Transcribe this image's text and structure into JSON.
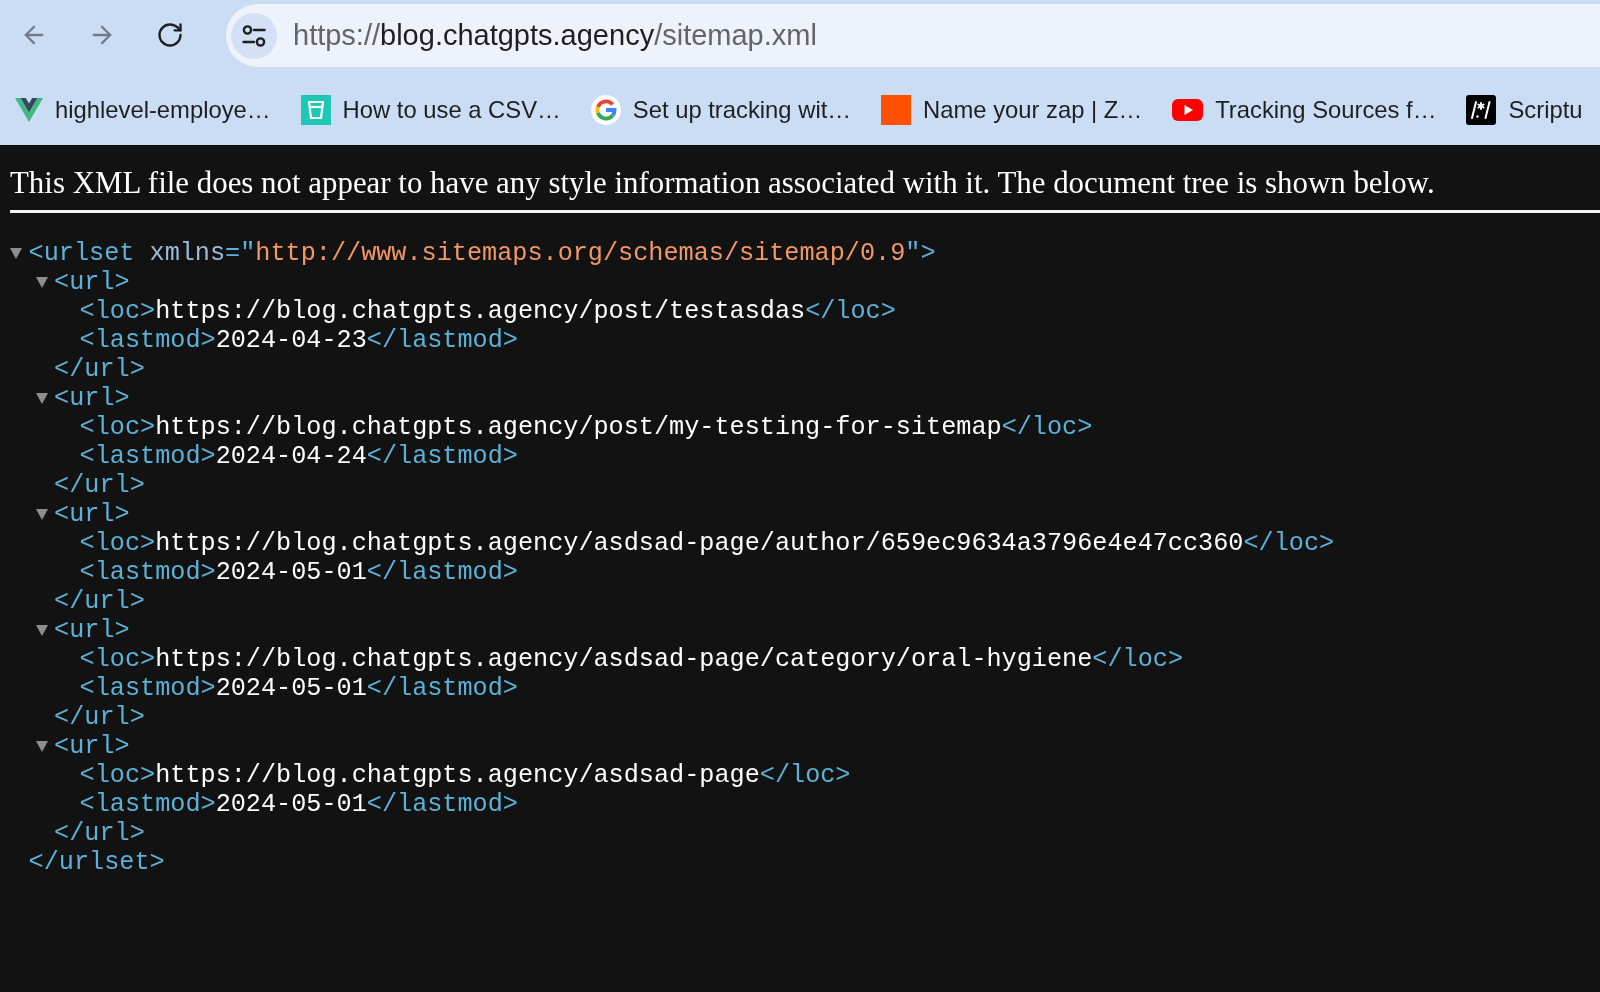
{
  "nav_buttons": [
    {
      "kind": "back",
      "disabled": true
    },
    {
      "kind": "forward",
      "disabled": true
    },
    {
      "kind": "reload",
      "disabled": false
    }
  ],
  "address_bar": {
    "scheme": "https://",
    "host": "blog.chatgpts.agency",
    "path": "/sitemap.xml"
  },
  "bookmarks": [
    {
      "kind": "v-logo",
      "label": "highlevel-employe…"
    },
    {
      "kind": "cup-tile",
      "label": "How to use a CSV…"
    },
    {
      "kind": "g-logo",
      "label": "Set up tracking wit…"
    },
    {
      "kind": "square",
      "label": "Name your zap | Z…"
    },
    {
      "kind": "play",
      "label": "Tracking Sources f…"
    },
    {
      "kind": "slash-tile",
      "label": "Scriptu"
    }
  ],
  "xml_notice": "This XML file does not appear to have any style information associated with it. The document tree is shown below.",
  "xml_tree": {
    "expanded": true,
    "open": [
      {
        "kind": "tag",
        "text": "<urlset"
      },
      {
        "kind": "attr-name",
        "text": "xmlns"
      },
      {
        "kind": "tag",
        "text": "=\""
      },
      {
        "kind": "attr-value",
        "text": "http://www.sitemaps.org/schemas/sitemap/0.9"
      },
      {
        "kind": "tag",
        "text": "\">"
      }
    ],
    "close": [
      {
        "kind": "tag",
        "text": "</urlset>"
      }
    ],
    "children": [
      {
        "expanded": true,
        "open": [
          {
            "kind": "tag",
            "text": "<url>"
          }
        ],
        "close": [
          {
            "kind": "tag",
            "text": "</url>"
          }
        ],
        "children": [
          {
            "open": [
              {
                "kind": "tag",
                "text": "<loc>"
              }
            ],
            "text": "https://blog.chatgpts.agency/post/testasdas",
            "close": [
              {
                "kind": "tag",
                "text": "</loc>"
              }
            ]
          },
          {
            "open": [
              {
                "kind": "tag",
                "text": "<lastmod>"
              }
            ],
            "text": "2024-04-23",
            "close": [
              {
                "kind": "tag",
                "text": "</lastmod>"
              }
            ]
          }
        ]
      },
      {
        "expanded": true,
        "open": [
          {
            "kind": "tag",
            "text": "<url>"
          }
        ],
        "close": [
          {
            "kind": "tag",
            "text": "</url>"
          }
        ],
        "children": [
          {
            "open": [
              {
                "kind": "tag",
                "text": "<loc>"
              }
            ],
            "text": "https://blog.chatgpts.agency/post/my-testing-for-sitemap",
            "close": [
              {
                "kind": "tag",
                "text": "</loc>"
              }
            ]
          },
          {
            "open": [
              {
                "kind": "tag",
                "text": "<lastmod>"
              }
            ],
            "text": "2024-04-24",
            "close": [
              {
                "kind": "tag",
                "text": "</lastmod>"
              }
            ]
          }
        ]
      },
      {
        "expanded": true,
        "open": [
          {
            "kind": "tag",
            "text": "<url>"
          }
        ],
        "close": [
          {
            "kind": "tag",
            "text": "</url>"
          }
        ],
        "children": [
          {
            "open": [
              {
                "kind": "tag",
                "text": "<loc>"
              }
            ],
            "text": "https://blog.chatgpts.agency/asdsad-page/author/659ec9634a3796e4e47cc360",
            "close": [
              {
                "kind": "tag",
                "text": "</loc>"
              }
            ]
          },
          {
            "open": [
              {
                "kind": "tag",
                "text": "<lastmod>"
              }
            ],
            "text": "2024-05-01",
            "close": [
              {
                "kind": "tag",
                "text": "</lastmod>"
              }
            ]
          }
        ]
      },
      {
        "expanded": true,
        "open": [
          {
            "kind": "tag",
            "text": "<url>"
          }
        ],
        "close": [
          {
            "kind": "tag",
            "text": "</url>"
          }
        ],
        "children": [
          {
            "open": [
              {
                "kind": "tag",
                "text": "<loc>"
              }
            ],
            "text": "https://blog.chatgpts.agency/asdsad-page/category/oral-hygiene",
            "close": [
              {
                "kind": "tag",
                "text": "</loc>"
              }
            ]
          },
          {
            "open": [
              {
                "kind": "tag",
                "text": "<lastmod>"
              }
            ],
            "text": "2024-05-01",
            "close": [
              {
                "kind": "tag",
                "text": "</lastmod>"
              }
            ]
          }
        ]
      },
      {
        "expanded": true,
        "open": [
          {
            "kind": "tag",
            "text": "<url>"
          }
        ],
        "close": [
          {
            "kind": "tag",
            "text": "</url>"
          }
        ],
        "children": [
          {
            "open": [
              {
                "kind": "tag",
                "text": "<loc>"
              }
            ],
            "text": "https://blog.chatgpts.agency/asdsad-page",
            "close": [
              {
                "kind": "tag",
                "text": "</loc>"
              }
            ]
          },
          {
            "open": [
              {
                "kind": "tag",
                "text": "<lastmod>"
              }
            ],
            "text": "2024-05-01",
            "close": [
              {
                "kind": "tag",
                "text": "</lastmod>"
              }
            ]
          }
        ]
      }
    ]
  }
}
